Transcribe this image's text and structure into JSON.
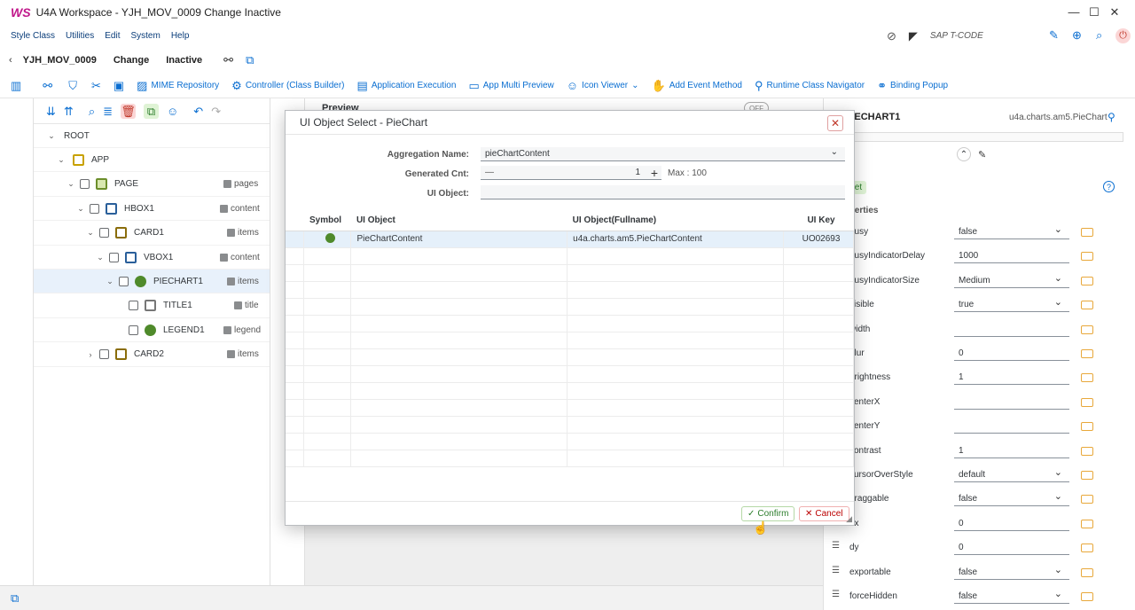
{
  "window": {
    "logo": "WS",
    "title": "U4A Workspace - YJH_MOV_0009 Change Inactive"
  },
  "menu": {
    "items": [
      "Style Class",
      "Utilities",
      "Edit",
      "System",
      "Help"
    ],
    "tcode_placeholder": "SAP T-CODE"
  },
  "header": {
    "app_name": "YJH_MOV_0009",
    "mode": "Change",
    "status": "Inactive"
  },
  "toolbar": {
    "items": [
      {
        "label": "MIME Repository",
        "icon": "image-icon"
      },
      {
        "label": "Controller (Class Builder)",
        "icon": "gear-icon"
      },
      {
        "label": "Application Execution",
        "icon": "display-icon"
      },
      {
        "label": "App Multi Preview",
        "icon": "screens-icon"
      },
      {
        "label": "Icon Viewer",
        "icon": "icon-viewer-icon"
      },
      {
        "label": "Add Event Method",
        "icon": "add-event-icon"
      },
      {
        "label": "Runtime Class Navigator",
        "icon": "pin-icon"
      },
      {
        "label": "Binding Popup",
        "icon": "link-icon"
      }
    ]
  },
  "tree": {
    "nodes": [
      {
        "label": "ROOT",
        "agg": "",
        "level": 0,
        "chevron": "down",
        "checkbox": false,
        "icon": ""
      },
      {
        "label": "APP",
        "agg": "",
        "level": 1,
        "chevron": "down",
        "checkbox": false,
        "icon": "app-icon"
      },
      {
        "label": "PAGE",
        "agg": "pages",
        "level": 2,
        "chevron": "down",
        "checkbox": true,
        "icon": "page-icon"
      },
      {
        "label": "HBOX1",
        "agg": "content",
        "level": 3,
        "chevron": "down",
        "checkbox": true,
        "icon": "hbox-icon"
      },
      {
        "label": "CARD1",
        "agg": "items",
        "level": 4,
        "chevron": "down",
        "checkbox": true,
        "icon": "card-icon"
      },
      {
        "label": "VBOX1",
        "agg": "content",
        "level": 5,
        "chevron": "down",
        "checkbox": true,
        "icon": "vbox-icon"
      },
      {
        "label": "PIECHART1",
        "agg": "items",
        "level": 6,
        "chevron": "down",
        "checkbox": true,
        "icon": "piechart-icon"
      },
      {
        "label": "TITLE1",
        "agg": "title",
        "level": 7,
        "chevron": "",
        "checkbox": true,
        "icon": "title-icon"
      },
      {
        "label": "LEGEND1",
        "agg": "legend",
        "level": 7,
        "chevron": "",
        "checkbox": true,
        "icon": "legend-icon"
      },
      {
        "label": "CARD2",
        "agg": "items",
        "level": 4,
        "chevron": "right",
        "checkbox": true,
        "icon": "card-icon"
      }
    ]
  },
  "preview": {
    "title": "Preview",
    "toggle": "OFF"
  },
  "properties": {
    "object_name": "PIECHART1",
    "object_class": "u4a.charts.am5.PieChart",
    "reset_label": "Reset",
    "section": "Properties",
    "rows": [
      {
        "label": "busy",
        "value": "false",
        "select": true
      },
      {
        "label": "busyIndicatorDelay",
        "value": "1000",
        "select": false
      },
      {
        "label": "busyIndicatorSize",
        "value": "Medium",
        "select": true
      },
      {
        "label": "visible",
        "value": "true",
        "select": true
      },
      {
        "label": "width",
        "value": "",
        "select": false
      },
      {
        "label": "blur",
        "value": "0",
        "select": false
      },
      {
        "label": "brightness",
        "value": "1",
        "select": false
      },
      {
        "label": "centerX",
        "value": "",
        "select": false
      },
      {
        "label": "centerY",
        "value": "",
        "select": false
      },
      {
        "label": "contrast",
        "value": "1",
        "select": false
      },
      {
        "label": "cursorOverStyle",
        "value": "default",
        "select": true
      },
      {
        "label": "draggable",
        "value": "false",
        "select": true
      },
      {
        "label": "dx",
        "value": "0",
        "select": false
      },
      {
        "label": "dy",
        "value": "0",
        "select": false
      },
      {
        "label": "exportable",
        "value": "false",
        "select": true
      },
      {
        "label": "forceHidden",
        "value": "false",
        "select": true
      }
    ]
  },
  "dialog": {
    "title": "UI Object Select - PieChart",
    "aggregation_label": "Aggregation Name:",
    "aggregation_value": "pieChartContent",
    "generated_label": "Generated Cnt:",
    "generated_value": "1",
    "max_label": "Max : 100",
    "uiobject_label": "UI Object:",
    "uiobject_value": "",
    "columns": [
      "Symbol",
      "UI Object",
      "UI Object(Fullname)",
      "UI Key"
    ],
    "rows": [
      {
        "symbol": "piechart-icon",
        "ui_object": "PieChartContent",
        "fullname": "u4a.charts.am5.PieChartContent",
        "ui_key": "UO02693"
      }
    ],
    "confirm_label": "Confirm",
    "cancel_label": "Cancel"
  },
  "colors": {
    "accent": "#0a6ed1",
    "brand": "#c0178a",
    "selection": "#e5f0fa",
    "confirm": "#2b7d2b",
    "cancel": "#bb0000"
  }
}
